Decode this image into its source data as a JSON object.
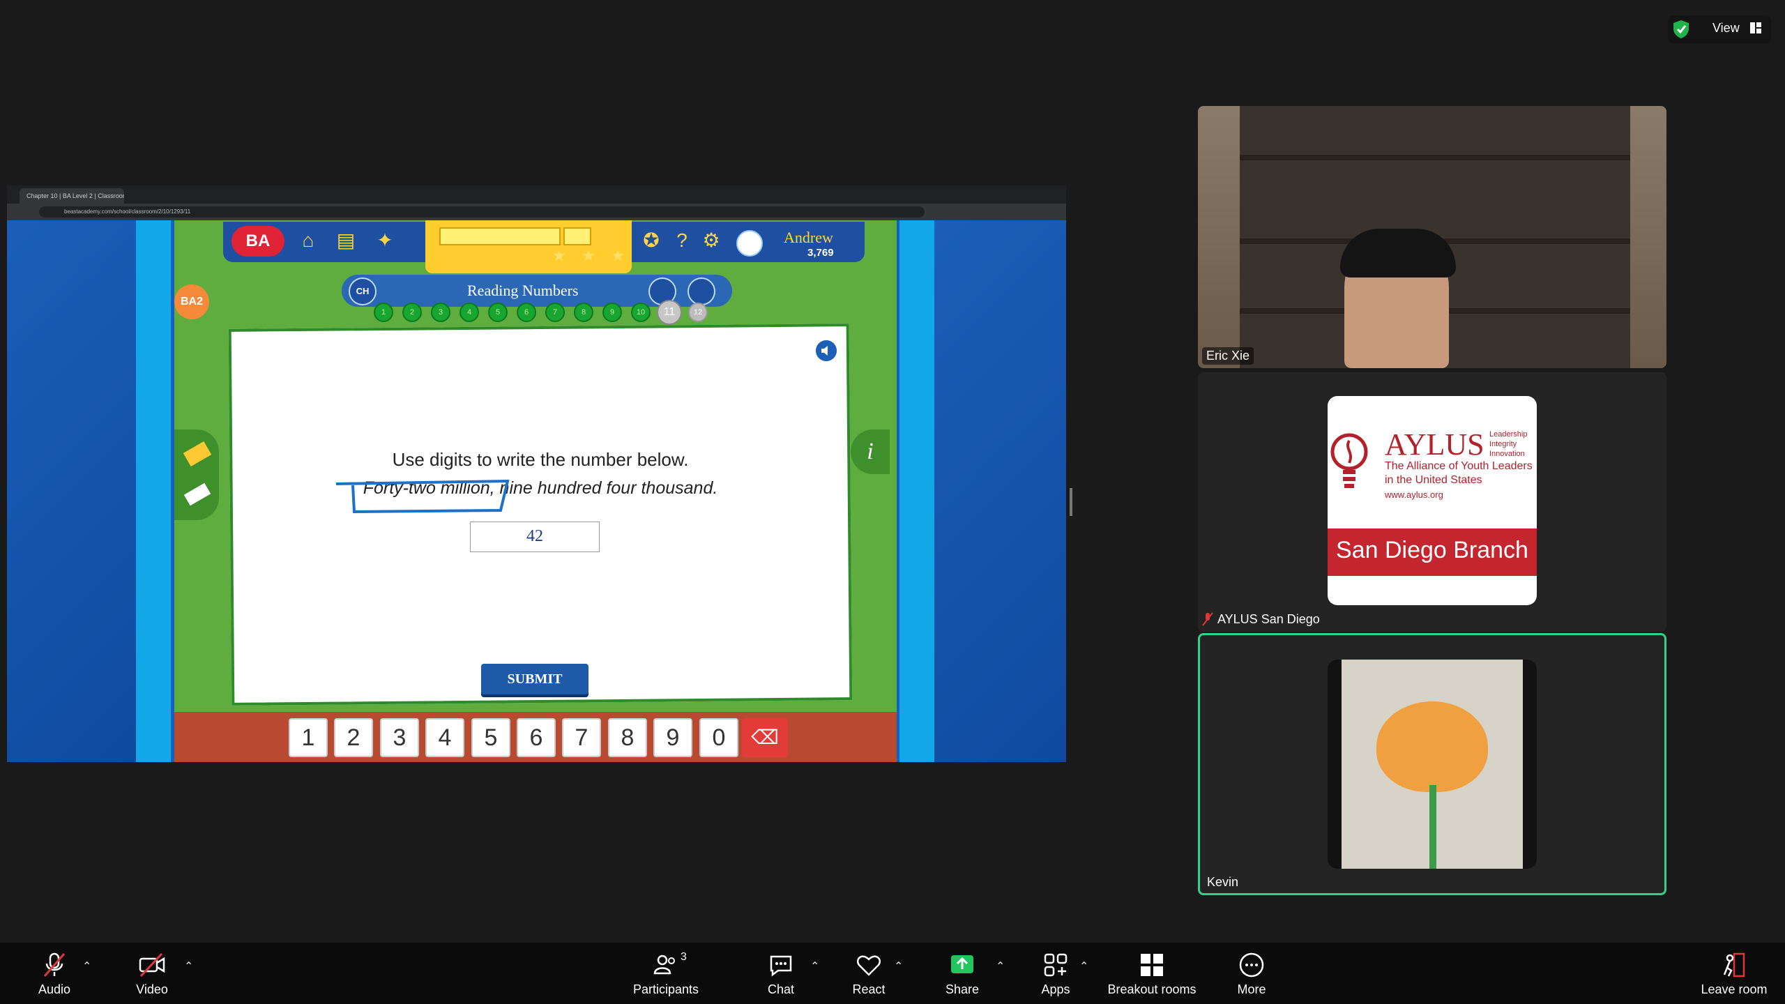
{
  "top_right": {
    "view_label": "View"
  },
  "browser": {
    "tab_title": "Chapter 10 | BA Level 2 | Classroom",
    "url": "beastacademy.com/school/classroom/2/10/1293/11"
  },
  "game": {
    "logo": "BA",
    "badge": "BA2",
    "user_name": "Andrew",
    "coins": "3,769",
    "chapter_badge": "CH",
    "lesson_title": "Reading Numbers",
    "problem_dots": [
      "1",
      "2",
      "3",
      "4",
      "5",
      "6",
      "7",
      "8",
      "9",
      "10",
      "11",
      "12"
    ],
    "question": "Use digits to write the number below.",
    "number_words": "Forty-two million, nine hundred four thousand.",
    "answer_value": "42",
    "submit_label": "SUBMIT",
    "info_label": "i",
    "keypad": [
      "1",
      "2",
      "3",
      "4",
      "5",
      "6",
      "7",
      "8",
      "9",
      "0"
    ]
  },
  "participants": [
    {
      "name": "Eric Xie"
    },
    {
      "name": "AYLUS San Diego"
    },
    {
      "name": "Kevin"
    }
  ],
  "aylus_logo": {
    "title": "AYLUS",
    "tagline": [
      "Leadership",
      "Integrity",
      "Innovation"
    ],
    "line1": "The Alliance of Youth Leaders",
    "line2": "in the United States",
    "url": "www.aylus.org",
    "branch": "San Diego Branch"
  },
  "toolbar": {
    "audio": "Audio",
    "video": "Video",
    "participants": "Participants",
    "participants_count": "3",
    "chat": "Chat",
    "react": "React",
    "share": "Share",
    "apps": "Apps",
    "breakout": "Breakout rooms",
    "more": "More",
    "leave": "Leave room"
  },
  "colors": {
    "share_green": "#2fd28a",
    "muted_red": "#e0363a",
    "accent_blue": "#1e5aa8"
  }
}
